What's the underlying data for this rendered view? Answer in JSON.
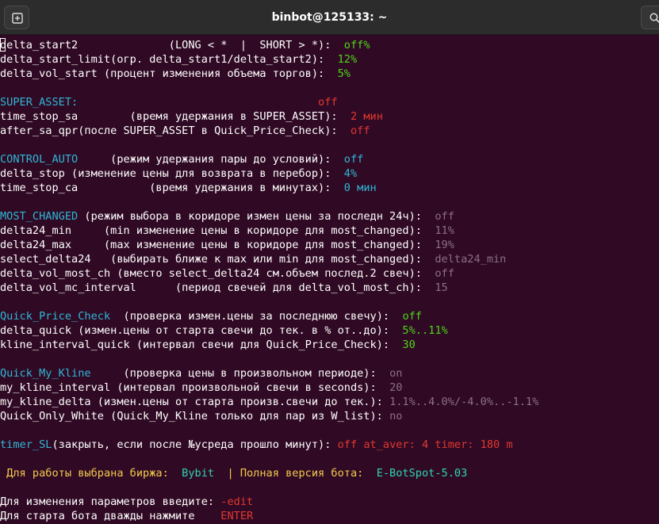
{
  "window": {
    "title": "binbot@125133: ~"
  },
  "colors": {
    "background": "#300a24",
    "white": "#ffffff",
    "green": "#4ed51a",
    "cyan": "#2fb6d6",
    "red": "#e2382f",
    "dim": "#8b6f86",
    "yellow": "#f2c94c",
    "teal": "#2ed3b3"
  },
  "lines": [
    [
      {
        "t": "delta_start2              (LONG < *  |  SHORT > *):  ",
        "c": "white"
      },
      {
        "t": "off%",
        "c": "green"
      }
    ],
    [
      {
        "t": "delta_start_limit(огр. delta_start1/delta_start2):  ",
        "c": "white"
      },
      {
        "t": "12%",
        "c": "green"
      }
    ],
    [
      {
        "t": "delta_vol_start (процент изменения объема торгов):  ",
        "c": "white"
      },
      {
        "t": "5%",
        "c": "green"
      }
    ],
    [],
    [
      {
        "t": "SUPER_ASSET:",
        "c": "cyan"
      },
      {
        "t": "                                     ",
        "c": "white"
      },
      {
        "t": "off",
        "c": "red"
      }
    ],
    [
      {
        "t": "time_stop_sa        (время удержания в SUPER_ASSET):  ",
        "c": "white"
      },
      {
        "t": "2 мин",
        "c": "red"
      }
    ],
    [
      {
        "t": "after_sa_qpr(после SUPER_ASSET в Quick_Price_Check):  ",
        "c": "white"
      },
      {
        "t": "off",
        "c": "red"
      }
    ],
    [],
    [
      {
        "t": "CONTROL_AUTO",
        "c": "cyan"
      },
      {
        "t": "     (режим удержания пары до условий):  ",
        "c": "white"
      },
      {
        "t": "off",
        "c": "cyan"
      }
    ],
    [
      {
        "t": "delta_stop (изменение цены для возврата в перебор):  ",
        "c": "white"
      },
      {
        "t": "4%",
        "c": "cyan"
      }
    ],
    [
      {
        "t": "time_stop_ca           (время удержания в минутах):  ",
        "c": "white"
      },
      {
        "t": "0 мин",
        "c": "cyan"
      }
    ],
    [],
    [
      {
        "t": "MOST_CHANGED",
        "c": "cyan"
      },
      {
        "t": " (режим выбора в коридоре измен цены за последн 24ч):  ",
        "c": "white"
      },
      {
        "t": "off",
        "c": "dim"
      }
    ],
    [
      {
        "t": "delta24_min     (min изменение цены в коридоре для most_changed):  ",
        "c": "white"
      },
      {
        "t": "11%",
        "c": "dim"
      }
    ],
    [
      {
        "t": "delta24_max     (max изменение цены в коридоре для most_changed):  ",
        "c": "white"
      },
      {
        "t": "19%",
        "c": "dim"
      }
    ],
    [
      {
        "t": "select_delta24   (выбирать ближе к max или min для most_changed):  ",
        "c": "white"
      },
      {
        "t": "delta24_min",
        "c": "dim"
      }
    ],
    [
      {
        "t": "delta_vol_most_ch (вместо select_delta24 см.объем послед.2 свеч):  ",
        "c": "white"
      },
      {
        "t": "off",
        "c": "dim"
      }
    ],
    [
      {
        "t": "delta_vol_mc_interval      (период свечей для delta_vol_most_ch):  ",
        "c": "white"
      },
      {
        "t": "15",
        "c": "dim"
      }
    ],
    [],
    [
      {
        "t": "Quick_Price_Check",
        "c": "cyan"
      },
      {
        "t": "  (проверка измен.цены за последнюю свечу):  ",
        "c": "white"
      },
      {
        "t": "off",
        "c": "green"
      }
    ],
    [
      {
        "t": "delta_quick (измен.цены от старта свечи до тек. в % от..до):  ",
        "c": "white"
      },
      {
        "t": "5%..11%",
        "c": "green"
      }
    ],
    [
      {
        "t": "kline_interval_quick (интервал свечи для Quick_Price_Check):  ",
        "c": "white"
      },
      {
        "t": "30",
        "c": "green"
      }
    ],
    [],
    [
      {
        "t": "Quick_My_Kline",
        "c": "cyan"
      },
      {
        "t": "     (проверка цены в произвольном периоде):  ",
        "c": "white"
      },
      {
        "t": "on",
        "c": "dim"
      }
    ],
    [
      {
        "t": "my_kline_interval (интервал произвольной свечи в seconds):  ",
        "c": "white"
      },
      {
        "t": "20",
        "c": "dim"
      }
    ],
    [
      {
        "t": "my_kline_delta (измен.цены от старта произв.свечи до тек.): ",
        "c": "white"
      },
      {
        "t": "1.1%..4.0%/-4.0%..-1.1%",
        "c": "dim"
      }
    ],
    [
      {
        "t": "Quick_Only_White (Quick_My_Kline только для пар из W_list): ",
        "c": "white"
      },
      {
        "t": "no",
        "c": "dim"
      }
    ],
    [],
    [
      {
        "t": "timer_SL",
        "c": "cyan"
      },
      {
        "t": "(закрыть, если после №усреда прошло минут): ",
        "c": "white"
      },
      {
        "t": "off at_aver: 4 timer: 180 m",
        "c": "red"
      }
    ],
    [],
    [
      {
        "t": " Для работы выбрана биржа:  ",
        "c": "yellow"
      },
      {
        "t": "Bybit",
        "c": "teal"
      },
      {
        "t": "  | Полная версия бота:  ",
        "c": "yellow"
      },
      {
        "t": "E-BotSpot-5.03",
        "c": "teal"
      }
    ],
    [],
    [
      {
        "t": "Для изменения параметров введите: ",
        "c": "white"
      },
      {
        "t": "-edit",
        "c": "red"
      }
    ],
    [
      {
        "t": "Для старта бота дважды нажмите    ",
        "c": "white"
      },
      {
        "t": "ENTER",
        "c": "red"
      }
    ]
  ]
}
